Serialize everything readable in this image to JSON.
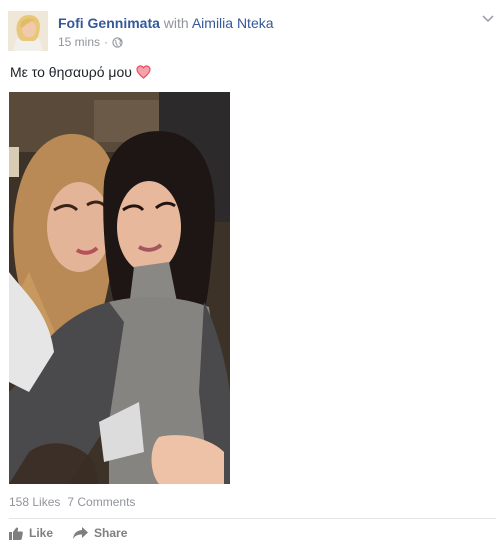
{
  "post": {
    "author": "Fofi Gennimata",
    "with_label": "with",
    "tagged": "Aimilia Nteka",
    "time": "15 mins",
    "separator": "·",
    "text": "Με το θησαυρό μου",
    "emoji_icon": "heart-icon",
    "privacy_icon": "globe-icon"
  },
  "engagement": {
    "likes": "158 Likes",
    "comments": "7 Comments"
  },
  "actions": {
    "like_label": "Like",
    "share_label": "Share"
  },
  "colors": {
    "link": "#365899",
    "meta": "#90949c",
    "heart": "#e8485f"
  }
}
